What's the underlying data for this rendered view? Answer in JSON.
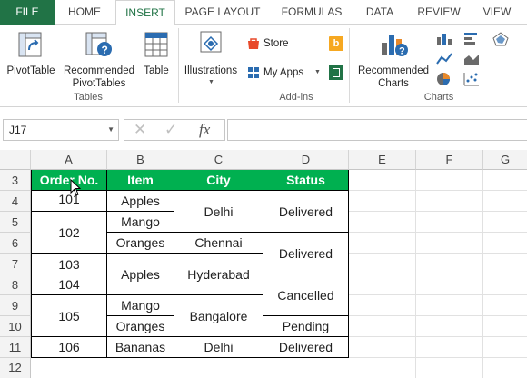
{
  "ribbon_tabs": [
    "FILE",
    "HOME",
    "INSERT",
    "PAGE LAYOUT",
    "FORMULAS",
    "DATA",
    "REVIEW",
    "VIEW"
  ],
  "active_tab": "INSERT",
  "ribbon": {
    "pivottable": "PivotTable",
    "recommended_pivottables_1": "Recommended",
    "recommended_pivottables_2": "PivotTables",
    "table": "Table",
    "tables_group": "Tables",
    "illustrations": "Illustrations",
    "store": "Store",
    "my_apps": "My Apps",
    "addins_group": "Add-ins",
    "recommended_charts_1": "Recommended",
    "recommended_charts_2": "Charts",
    "charts_group": "Charts"
  },
  "formula_bar": {
    "name_box": "J17",
    "fx": "fx",
    "formula": ""
  },
  "columns": [
    "A",
    "B",
    "C",
    "D",
    "E",
    "F",
    "G"
  ],
  "rows": [
    "3",
    "4",
    "5",
    "6",
    "7",
    "8",
    "9",
    "10",
    "11",
    "12"
  ],
  "table": {
    "headers": [
      "Order No.",
      "Item",
      "City",
      "Status"
    ],
    "order_no": [
      "101",
      "102",
      "103",
      "104",
      "105",
      "106"
    ],
    "items": [
      "Apples",
      "Mango",
      "Oranges",
      "Apples",
      "Mango",
      "Oranges",
      "Bananas"
    ],
    "cities": [
      "Delhi",
      "Chennai",
      "Hyderabad",
      "Bangalore",
      "Delhi"
    ],
    "statuses": [
      "Delivered",
      "Delivered",
      "Cancelled",
      "Pending",
      "Delivered"
    ]
  },
  "colors": {
    "accent": "#217346",
    "header_fill": "#00b050"
  }
}
